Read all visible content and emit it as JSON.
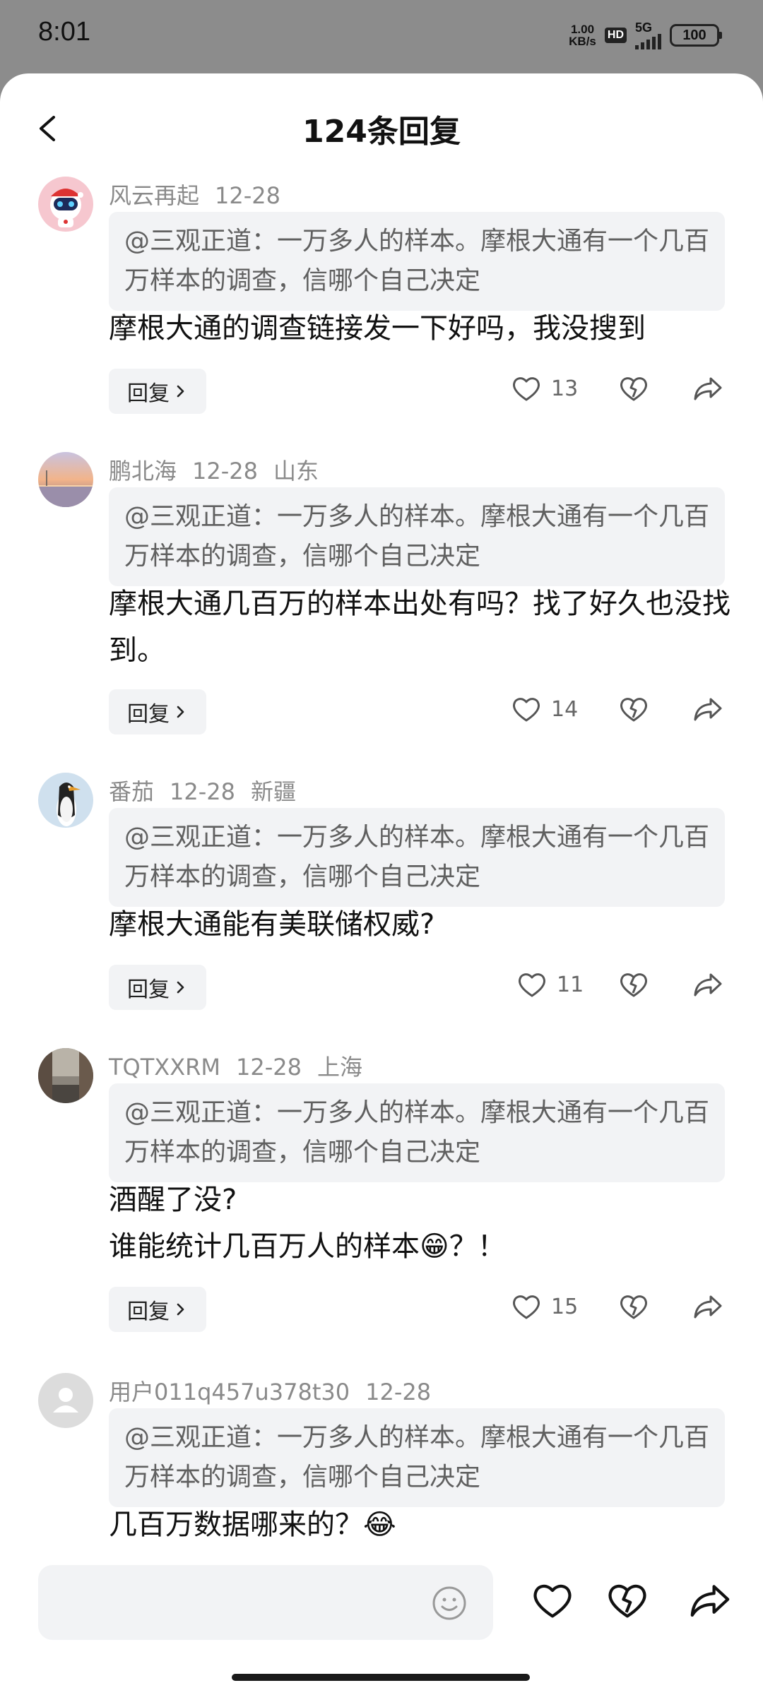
{
  "status_bar": {
    "time": "8:01",
    "net_speed_value": "1.00",
    "net_speed_unit": "KB/s",
    "hd": "HD",
    "network": "5G",
    "battery": "100"
  },
  "header": {
    "title": "124条回复"
  },
  "reply_label": "回复",
  "comments": [
    {
      "username": "风云再起",
      "date": "12-28",
      "location": "",
      "quote": "@三观正道：一万多人的样本。摩根大通有一个几百万样本的调查，信哪个自己决定",
      "text": "摩根大通的调查链接发一下好吗，我没搜到",
      "likes": "13"
    },
    {
      "username": "鹏北海",
      "date": "12-28",
      "location": "山东",
      "quote": "@三观正道：一万多人的样本。摩根大通有一个几百万样本的调查，信哪个自己决定",
      "text": "摩根大通几百万的样本出处有吗？找了好久也没找到。",
      "likes": "14"
    },
    {
      "username": "番茄",
      "date": "12-28",
      "location": "新疆",
      "quote": "@三观正道：一万多人的样本。摩根大通有一个几百万样本的调查，信哪个自己决定",
      "text": "摩根大通能有美联储权威?",
      "likes": "11"
    },
    {
      "username": "TQTXXRM",
      "date": "12-28",
      "location": "上海",
      "quote": "@三观正道：一万多人的样本。摩根大通有一个几百万样本的调查，信哪个自己决定",
      "text_line1": "酒醒了没?",
      "text_line2_before": "谁能统计几百万人的样本",
      "text_line2_emoji": "😁",
      "text_line2_after": "？！",
      "likes": "15"
    },
    {
      "username": "用户011q457u378t30",
      "date": "12-28",
      "location": "",
      "quote": "@三观正道：一万多人的样本。摩根大通有一个几百万样本的调查，信哪个自己决定",
      "text": "几百万数据哪来的？",
      "text_emoji": "😂"
    }
  ],
  "colors": {
    "accent_text": "#111111",
    "meta_text": "#8a8a8a",
    "quote_bg": "#f2f3f5"
  },
  "icons": [
    "back-arrow-icon",
    "heart-icon",
    "broken-heart-icon",
    "share-icon",
    "emoji-icon",
    "chevron-right-icon"
  ]
}
